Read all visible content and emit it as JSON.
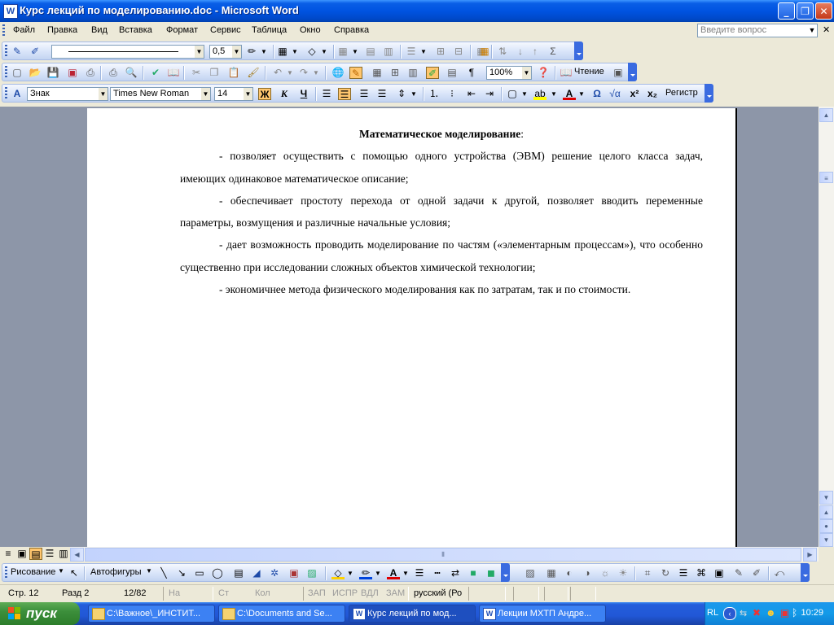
{
  "window": {
    "title": "Курс лекций по моделированию.doc - Microsoft Word",
    "app_icon": "W"
  },
  "menu": {
    "items": [
      "Файл",
      "Правка",
      "Вид",
      "Вставка",
      "Формат",
      "Сервис",
      "Таблица",
      "Окно",
      "Справка"
    ],
    "ask_placeholder": "Введите вопрос"
  },
  "toolbar_tables": {
    "line_width": "0,5"
  },
  "toolbar_standard": {
    "zoom": "100%",
    "reading_label": "Чтение"
  },
  "toolbar_format": {
    "style": "Знак",
    "font": "Times New Roman",
    "size": "14",
    "bold": "Ж",
    "italic": "К",
    "underline": "Ч",
    "register": "Регистр",
    "omega": "Ω"
  },
  "document": {
    "heading": "Математическое моделирование",
    "heading_suffix": ":",
    "paragraphs": [
      "- позволяет осуществить с помощью одного устройства (ЭВМ)  решение целого класса задач, имеющих одинаковое математическое описание;",
      "- обеспечивает простоту перехода от одной задачи к другой, позволяет вводить переменные параметры, возмущения и различные начальные условия;",
      "- дает возможность проводить моделирование по частям («элементарным процессам»), что особенно существенно при исследовании сложных объектов химической технологии;",
      "- экономичнее метода физического моделирования как по затратам, так и по стоимости."
    ]
  },
  "drawing_toolbar": {
    "draw_label": "Рисование",
    "autoshapes_label": "Автофигуры"
  },
  "status": {
    "page": "Стр. 12",
    "section": "Разд 2",
    "pages": "12/82",
    "at": "На",
    "line": "Ст",
    "col": "Кол",
    "rec": "ЗАП",
    "trk": "ИСПР",
    "ext": "ВДЛ",
    "ovr": "ЗАМ",
    "language": "русский (Ро"
  },
  "taskbar": {
    "start_label": "пуск",
    "tasks": [
      {
        "label": "C:\\Важное\\_ИНСТИТ...",
        "icon": "folder-icon"
      },
      {
        "label": "C:\\Documents and Se...",
        "icon": "folder-icon"
      },
      {
        "label": "Курс лекций по мод...",
        "icon": "word-icon"
      },
      {
        "label": "Лекции МХТП Андре...",
        "icon": "word-icon"
      }
    ],
    "lang": "RL",
    "clock": "10:29"
  }
}
